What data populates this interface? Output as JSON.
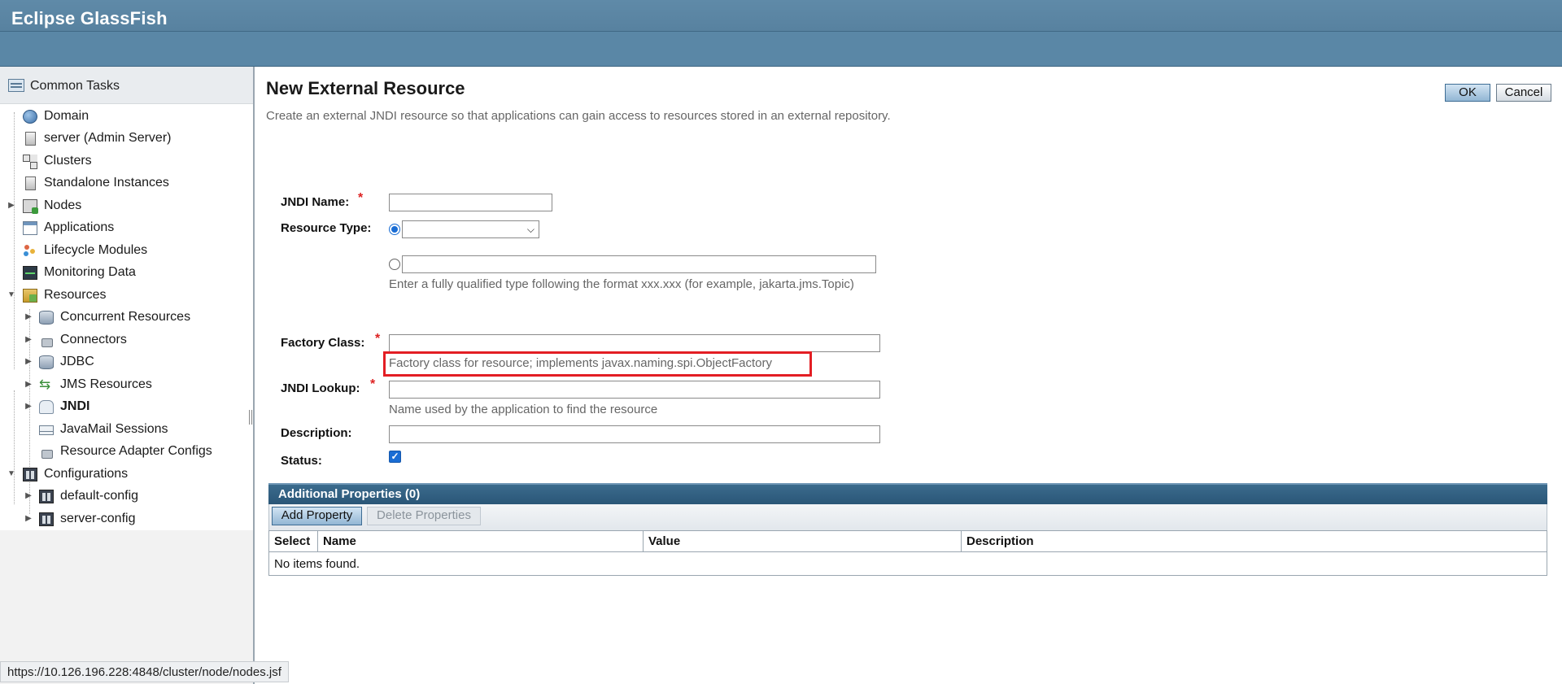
{
  "masthead": {
    "brand": "Eclipse GlassFish"
  },
  "sidebar": {
    "common_tasks": "Common Tasks",
    "items": [
      {
        "label": "Domain",
        "icon": "globe-icon"
      },
      {
        "label": "server (Admin Server)",
        "icon": "server-icon"
      },
      {
        "label": "Clusters",
        "icon": "clusters-icon"
      },
      {
        "label": "Standalone Instances",
        "icon": "server-icon"
      },
      {
        "label": "Nodes",
        "icon": "node-icon"
      },
      {
        "label": "Applications",
        "icon": "applications-icon"
      },
      {
        "label": "Lifecycle Modules",
        "icon": "lifecycle-icon"
      },
      {
        "label": "Monitoring Data",
        "icon": "monitoring-icon"
      },
      {
        "label": "Resources",
        "icon": "resources-icon"
      },
      {
        "label": "Concurrent Resources",
        "icon": "database-icon"
      },
      {
        "label": "Connectors",
        "icon": "connector-icon"
      },
      {
        "label": "JDBC",
        "icon": "database-icon"
      },
      {
        "label": "JMS Resources",
        "icon": "jms-icon"
      },
      {
        "label": "JNDI",
        "icon": "jndi-icon"
      },
      {
        "label": "JavaMail Sessions",
        "icon": "mail-icon"
      },
      {
        "label": "Resource Adapter Configs",
        "icon": "connector-icon"
      },
      {
        "label": "Configurations",
        "icon": "configuration-icon"
      },
      {
        "label": "default-config",
        "icon": "configuration-icon"
      },
      {
        "label": "server-config",
        "icon": "configuration-icon"
      }
    ]
  },
  "page": {
    "title": "New External Resource",
    "help": "Create an external JNDI resource so that applications can gain access to resources stored in an external repository.",
    "ok_label": "OK",
    "cancel_label": "Cancel"
  },
  "form": {
    "jndi_name_label": "JNDI Name:",
    "jndi_name_value": "",
    "resource_type_label": "Resource Type:",
    "resource_type_selected": "",
    "resource_type_custom_value": "",
    "resource_type_hint": "Enter a fully qualified type following the format xxx.xxx (for example, jakarta.jms.Topic)",
    "factory_class_label": "Factory Class:",
    "factory_class_value": "",
    "factory_class_hint": "Factory class for resource; implements javax.naming.spi.ObjectFactory",
    "jndi_lookup_label": "JNDI Lookup:",
    "jndi_lookup_value": "",
    "jndi_lookup_hint": "Name used by the application to find the resource",
    "description_label": "Description:",
    "description_value": "",
    "status_label": "Status:",
    "status_checked": true,
    "required_marker": "*"
  },
  "properties": {
    "title": "Additional Properties (0)",
    "add_label": "Add Property",
    "delete_label": "Delete Properties",
    "columns": [
      "Select",
      "Name",
      "Value",
      "Description"
    ],
    "empty_text": "No items found."
  },
  "statusbar": {
    "url": "https://10.126.196.228:4848/cluster/node/nodes.jsf"
  },
  "colors": {
    "masthead": "#5a87a6",
    "table_header": "#2a5677",
    "highlight": "#e31e24",
    "required": "#dd2222"
  }
}
